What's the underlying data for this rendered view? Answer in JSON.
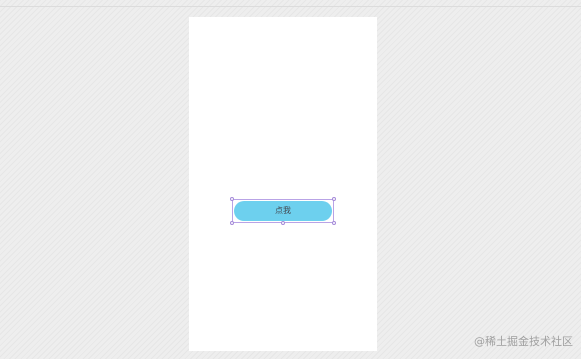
{
  "canvas": {
    "background_color": "#eeeeee",
    "artboard_color": "#ffffff"
  },
  "button": {
    "label": "点我",
    "fill_color": "#6dd0ee",
    "text_color": "#444c55",
    "selected": true
  },
  "selection": {
    "outline_color": "#b9a3e6"
  },
  "watermark": {
    "text": "@稀土掘金技术社区"
  }
}
